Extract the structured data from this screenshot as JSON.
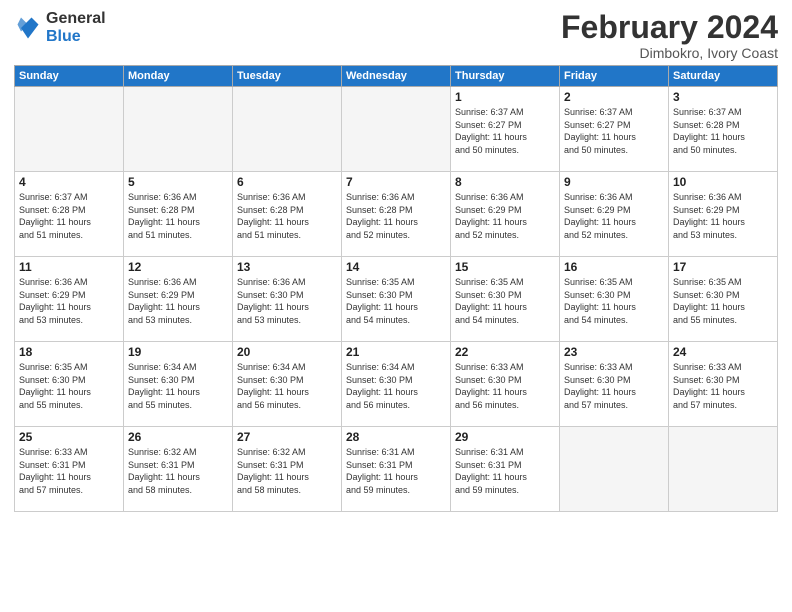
{
  "header": {
    "logo_line1": "General",
    "logo_line2": "Blue",
    "month": "February 2024",
    "location": "Dimbokro, Ivory Coast"
  },
  "days_of_week": [
    "Sunday",
    "Monday",
    "Tuesday",
    "Wednesday",
    "Thursday",
    "Friday",
    "Saturday"
  ],
  "weeks": [
    [
      {
        "day": "",
        "info": ""
      },
      {
        "day": "",
        "info": ""
      },
      {
        "day": "",
        "info": ""
      },
      {
        "day": "",
        "info": ""
      },
      {
        "day": "1",
        "info": "Sunrise: 6:37 AM\nSunset: 6:27 PM\nDaylight: 11 hours\nand 50 minutes."
      },
      {
        "day": "2",
        "info": "Sunrise: 6:37 AM\nSunset: 6:27 PM\nDaylight: 11 hours\nand 50 minutes."
      },
      {
        "day": "3",
        "info": "Sunrise: 6:37 AM\nSunset: 6:28 PM\nDaylight: 11 hours\nand 50 minutes."
      }
    ],
    [
      {
        "day": "4",
        "info": "Sunrise: 6:37 AM\nSunset: 6:28 PM\nDaylight: 11 hours\nand 51 minutes."
      },
      {
        "day": "5",
        "info": "Sunrise: 6:36 AM\nSunset: 6:28 PM\nDaylight: 11 hours\nand 51 minutes."
      },
      {
        "day": "6",
        "info": "Sunrise: 6:36 AM\nSunset: 6:28 PM\nDaylight: 11 hours\nand 51 minutes."
      },
      {
        "day": "7",
        "info": "Sunrise: 6:36 AM\nSunset: 6:28 PM\nDaylight: 11 hours\nand 52 minutes."
      },
      {
        "day": "8",
        "info": "Sunrise: 6:36 AM\nSunset: 6:29 PM\nDaylight: 11 hours\nand 52 minutes."
      },
      {
        "day": "9",
        "info": "Sunrise: 6:36 AM\nSunset: 6:29 PM\nDaylight: 11 hours\nand 52 minutes."
      },
      {
        "day": "10",
        "info": "Sunrise: 6:36 AM\nSunset: 6:29 PM\nDaylight: 11 hours\nand 53 minutes."
      }
    ],
    [
      {
        "day": "11",
        "info": "Sunrise: 6:36 AM\nSunset: 6:29 PM\nDaylight: 11 hours\nand 53 minutes."
      },
      {
        "day": "12",
        "info": "Sunrise: 6:36 AM\nSunset: 6:29 PM\nDaylight: 11 hours\nand 53 minutes."
      },
      {
        "day": "13",
        "info": "Sunrise: 6:36 AM\nSunset: 6:30 PM\nDaylight: 11 hours\nand 53 minutes."
      },
      {
        "day": "14",
        "info": "Sunrise: 6:35 AM\nSunset: 6:30 PM\nDaylight: 11 hours\nand 54 minutes."
      },
      {
        "day": "15",
        "info": "Sunrise: 6:35 AM\nSunset: 6:30 PM\nDaylight: 11 hours\nand 54 minutes."
      },
      {
        "day": "16",
        "info": "Sunrise: 6:35 AM\nSunset: 6:30 PM\nDaylight: 11 hours\nand 54 minutes."
      },
      {
        "day": "17",
        "info": "Sunrise: 6:35 AM\nSunset: 6:30 PM\nDaylight: 11 hours\nand 55 minutes."
      }
    ],
    [
      {
        "day": "18",
        "info": "Sunrise: 6:35 AM\nSunset: 6:30 PM\nDaylight: 11 hours\nand 55 minutes."
      },
      {
        "day": "19",
        "info": "Sunrise: 6:34 AM\nSunset: 6:30 PM\nDaylight: 11 hours\nand 55 minutes."
      },
      {
        "day": "20",
        "info": "Sunrise: 6:34 AM\nSunset: 6:30 PM\nDaylight: 11 hours\nand 56 minutes."
      },
      {
        "day": "21",
        "info": "Sunrise: 6:34 AM\nSunset: 6:30 PM\nDaylight: 11 hours\nand 56 minutes."
      },
      {
        "day": "22",
        "info": "Sunrise: 6:33 AM\nSunset: 6:30 PM\nDaylight: 11 hours\nand 56 minutes."
      },
      {
        "day": "23",
        "info": "Sunrise: 6:33 AM\nSunset: 6:30 PM\nDaylight: 11 hours\nand 57 minutes."
      },
      {
        "day": "24",
        "info": "Sunrise: 6:33 AM\nSunset: 6:30 PM\nDaylight: 11 hours\nand 57 minutes."
      }
    ],
    [
      {
        "day": "25",
        "info": "Sunrise: 6:33 AM\nSunset: 6:31 PM\nDaylight: 11 hours\nand 57 minutes."
      },
      {
        "day": "26",
        "info": "Sunrise: 6:32 AM\nSunset: 6:31 PM\nDaylight: 11 hours\nand 58 minutes."
      },
      {
        "day": "27",
        "info": "Sunrise: 6:32 AM\nSunset: 6:31 PM\nDaylight: 11 hours\nand 58 minutes."
      },
      {
        "day": "28",
        "info": "Sunrise: 6:31 AM\nSunset: 6:31 PM\nDaylight: 11 hours\nand 59 minutes."
      },
      {
        "day": "29",
        "info": "Sunrise: 6:31 AM\nSunset: 6:31 PM\nDaylight: 11 hours\nand 59 minutes."
      },
      {
        "day": "",
        "info": ""
      },
      {
        "day": "",
        "info": ""
      }
    ]
  ]
}
